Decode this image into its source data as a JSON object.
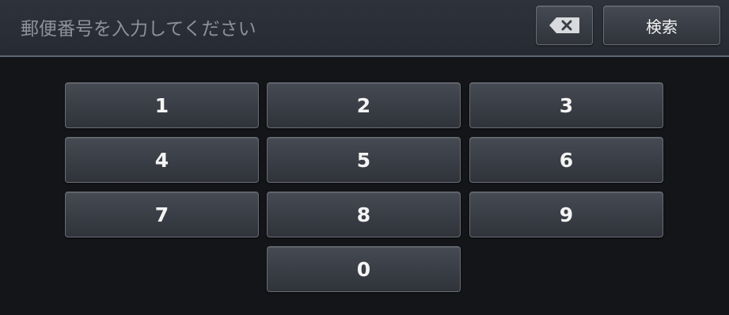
{
  "input": {
    "placeholder": "郵便番号を入力してください"
  },
  "toolbar": {
    "backspace_icon": "backspace-icon",
    "search_label": "検索"
  },
  "keypad": {
    "keys": [
      "1",
      "2",
      "3",
      "4",
      "5",
      "6",
      "7",
      "8",
      "9",
      "0"
    ]
  },
  "colors": {
    "background": "#141518",
    "header": "#2a2e36",
    "header_divider": "#5e6678",
    "button_face": "#3a3e46",
    "button_border": "#686c75",
    "placeholder_text": "#8d919a",
    "key_text": "#f4f4f4"
  }
}
